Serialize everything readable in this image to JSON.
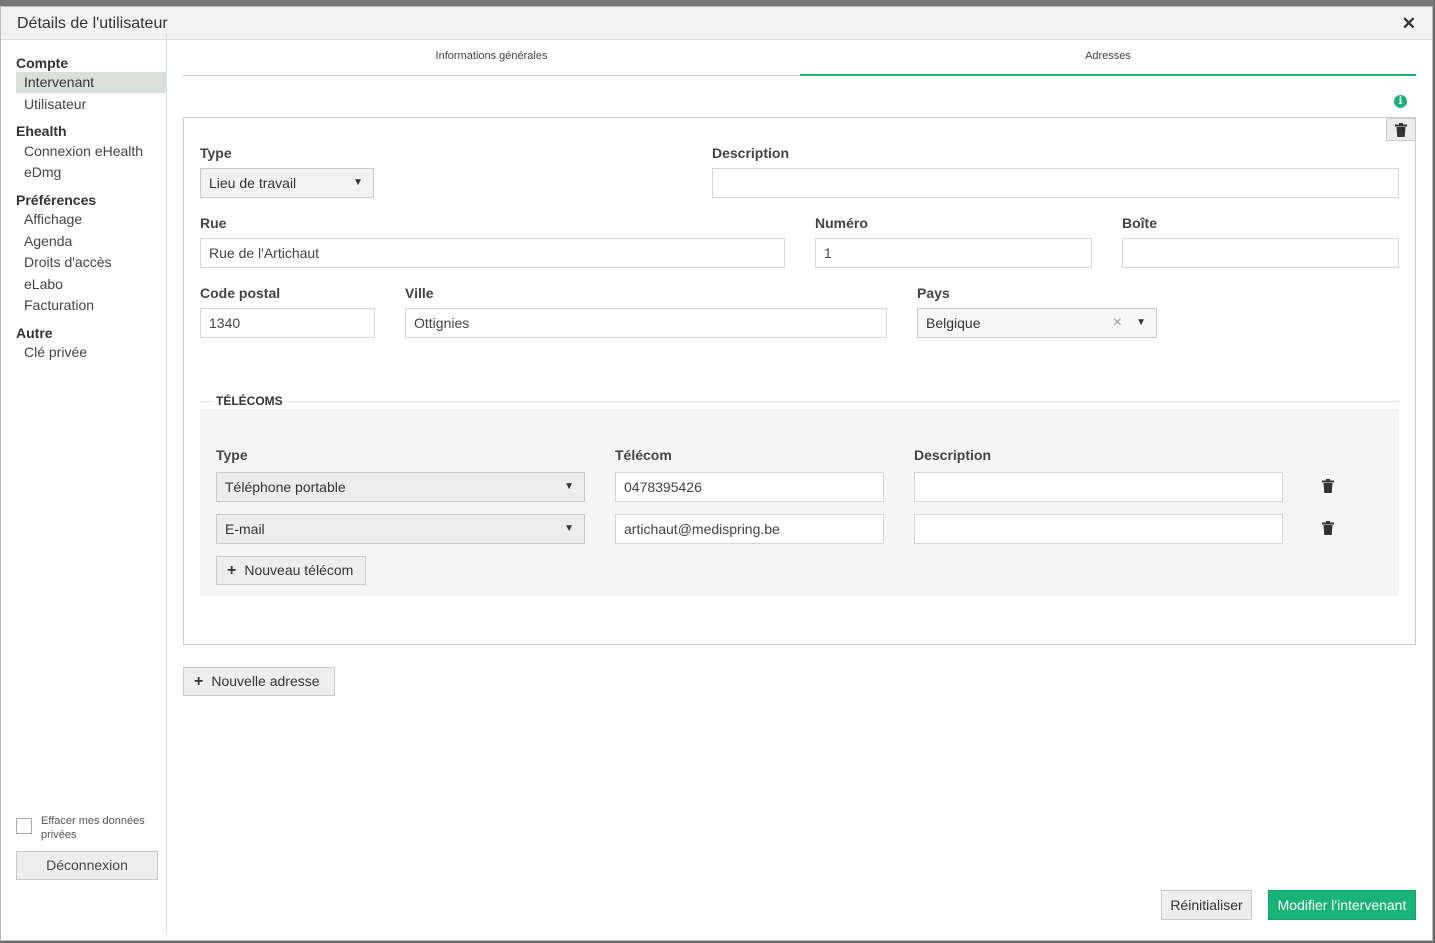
{
  "dialog": {
    "title": "Détails de l'utilisateur",
    "close": "✕"
  },
  "sidebar": {
    "groups": [
      {
        "label": "Compte",
        "items": [
          "Intervenant",
          "Utilisateur"
        ]
      },
      {
        "label": "Ehealth",
        "items": [
          "Connexion eHealth",
          "eDmg"
        ]
      },
      {
        "label": "Préférences",
        "items": [
          "Affichage",
          "Agenda",
          "Droits d'accès",
          "eLabo",
          "Facturation"
        ]
      },
      {
        "label": "Autre",
        "items": [
          "Clé privée"
        ]
      }
    ],
    "active_item": "Intervenant",
    "erase_label": "Effacer mes données privées",
    "logout_label": "Déconnexion"
  },
  "tabs": [
    {
      "label": "Informations générales",
      "active": false
    },
    {
      "label": "Adresses",
      "active": true
    }
  ],
  "address": {
    "type_label": "Type",
    "type_value": "Lieu de travail",
    "description_label": "Description",
    "description_value": "",
    "street_label": "Rue",
    "street_value": "Rue de l'Artichaut",
    "number_label": "Numéro",
    "number_value": "1",
    "box_label": "Boîte",
    "box_value": "",
    "postal_label": "Code postal",
    "postal_value": "1340",
    "city_label": "Ville",
    "city_value": "Ottignies",
    "country_label": "Pays",
    "country_value": "Belgique"
  },
  "telecoms": {
    "title": "TÉLÉCOMS",
    "headers": {
      "type": "Type",
      "telecom": "Télécom",
      "description": "Description"
    },
    "rows": [
      {
        "type": "Téléphone portable",
        "value": "0478395426",
        "description": ""
      },
      {
        "type": "E-mail",
        "value": "artichaut@medispring.be",
        "description": ""
      }
    ],
    "add_label": "Nouveau télécom"
  },
  "new_address_label": "Nouvelle adresse",
  "footer": {
    "reset_label": "Réinitialiser",
    "submit_label": "Modifier l'intervenant"
  },
  "colors": {
    "accent": "#18b477",
    "active_tab": "#26b07a",
    "sidebar_active": "#d9e0dc"
  },
  "icons": [
    "close-icon",
    "info-icon",
    "trash-icon",
    "caret-down-icon",
    "clear-icon",
    "plus-icon"
  ]
}
